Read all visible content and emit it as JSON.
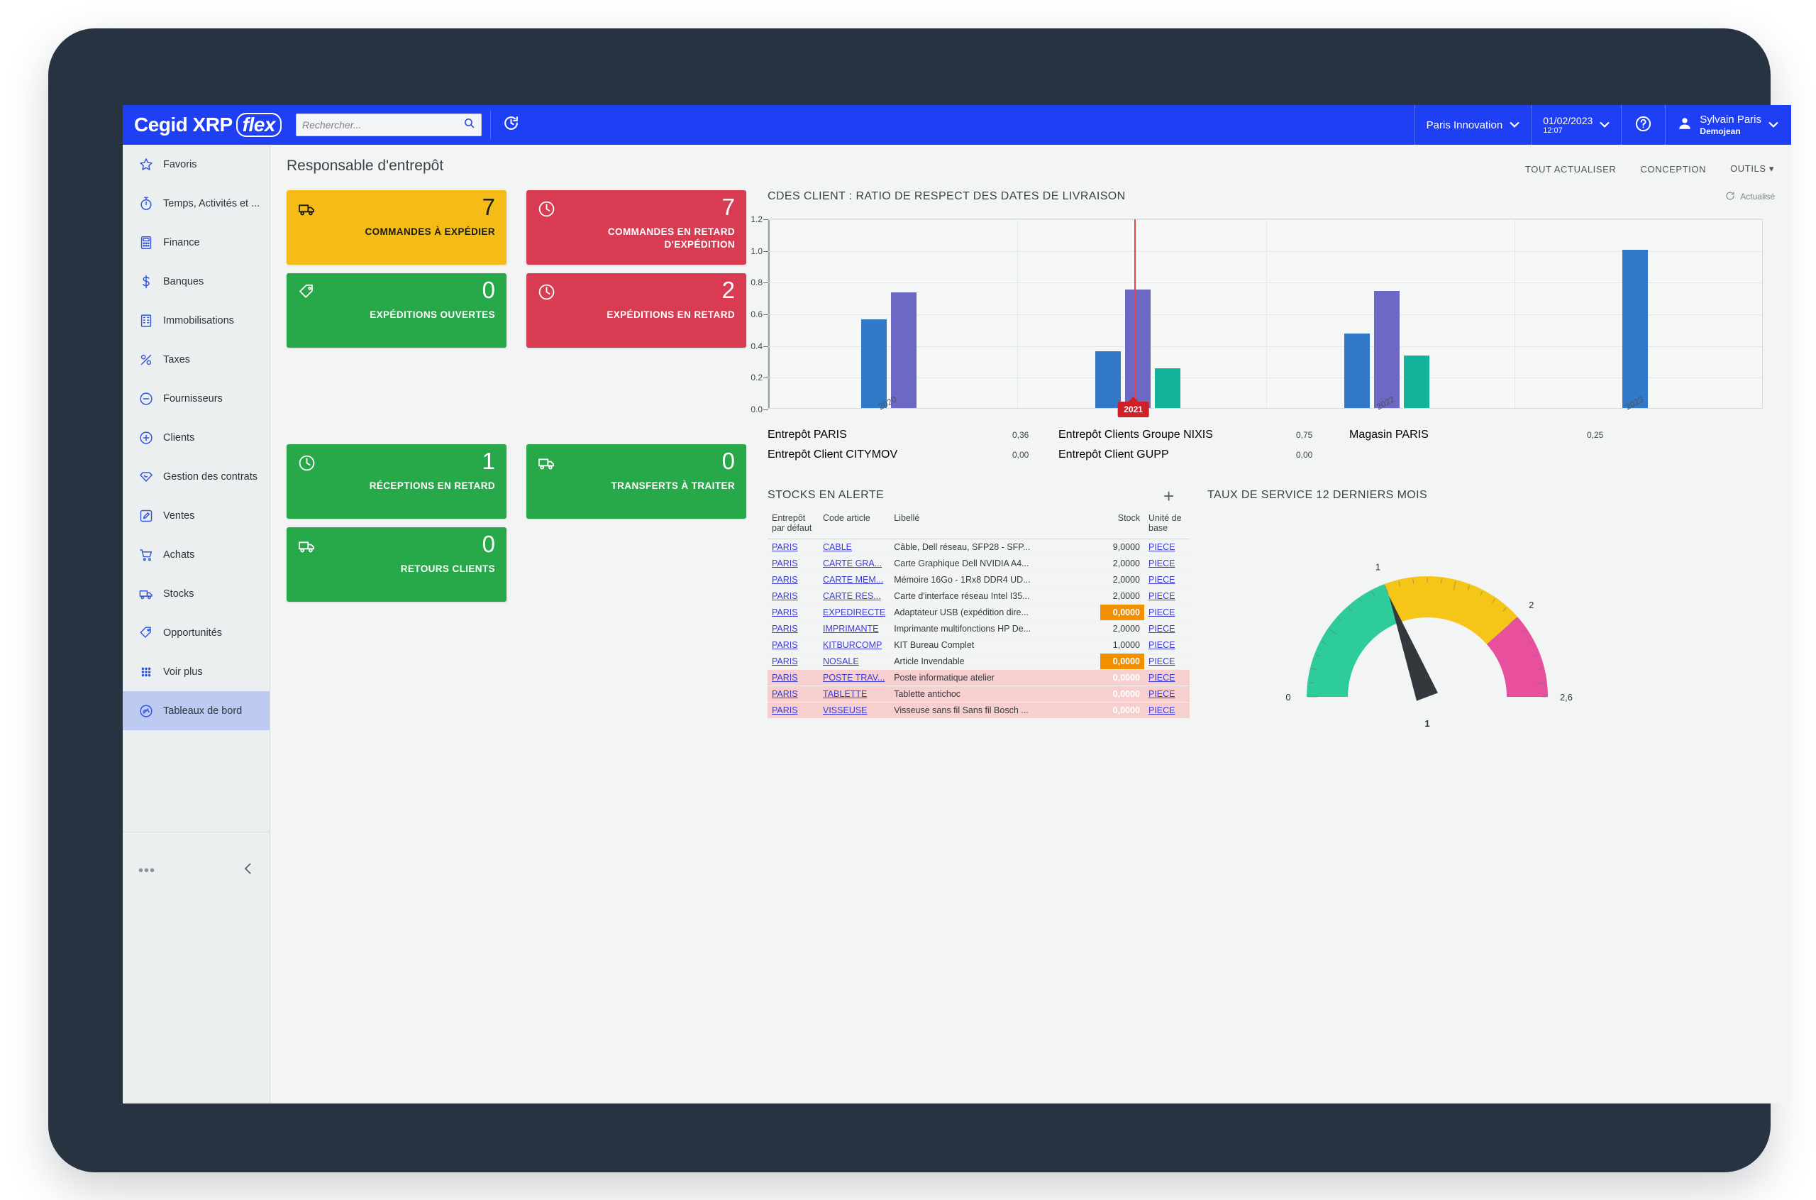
{
  "app": {
    "logo_main": "Cegid XRP",
    "logo_accent": "flex"
  },
  "header": {
    "search_placeholder": "Rechercher...",
    "search_value": "",
    "search_icon": "search-icon",
    "history_icon": "history-refresh-icon",
    "org": "Paris Innovation",
    "date": "01/02/2023",
    "time": "12:07",
    "help_icon": "help-circle-icon",
    "user_icon": "user-avatar-icon",
    "user_name": "Sylvain Paris",
    "user_sub": "Demojean",
    "caret": "⌄"
  },
  "page": {
    "title": "Responsable d'entrepôt",
    "actions": [
      "TOUT ACTUALISER",
      "CONCEPTION",
      "OUTILS ▾"
    ]
  },
  "sidebar": {
    "items": [
      {
        "label": "Favoris",
        "icon": "star-icon",
        "active": false
      },
      {
        "label": "Temps, Activités et ...",
        "icon": "stopwatch-icon",
        "active": false
      },
      {
        "label": "Finance",
        "icon": "calculator-icon",
        "active": false
      },
      {
        "label": "Banques",
        "icon": "dollar-icon",
        "active": false
      },
      {
        "label": "Immobilisations",
        "icon": "building-icon",
        "active": false
      },
      {
        "label": "Taxes",
        "icon": "percent-icon",
        "active": false
      },
      {
        "label": "Fournisseurs",
        "icon": "minus-circle-icon",
        "active": false
      },
      {
        "label": "Clients",
        "icon": "plus-circle-icon",
        "active": false
      },
      {
        "label": "Gestion des contrats",
        "icon": "contract-icon",
        "active": false
      },
      {
        "label": "Ventes",
        "icon": "pencil-square-icon",
        "active": false
      },
      {
        "label": "Achats",
        "icon": "cart-icon",
        "active": false
      },
      {
        "label": "Stocks",
        "icon": "truck-icon",
        "active": false
      },
      {
        "label": "Opportunités",
        "icon": "tag-icon",
        "active": false
      },
      {
        "label": "Voir plus",
        "icon": "grid-dots-icon",
        "active": false
      },
      {
        "label": "Tableaux de bord",
        "icon": "gauge-icon",
        "active": true
      }
    ],
    "more_icon": "ellipsis-icon",
    "collapse_icon": "chevron-left-icon"
  },
  "tiles": [
    {
      "value": "7",
      "label": "COMMANDES À EXPÉDIER",
      "color": "amber",
      "icon": "truck-icon"
    },
    {
      "value": "7",
      "label": "COMMANDES EN RETARD D'EXPÉDITION",
      "color": "red",
      "icon": "clock-icon"
    },
    {
      "value": "0",
      "label": "EXPÉDITIONS OUVERTES",
      "color": "green",
      "icon": "tag-icon"
    },
    {
      "value": "2",
      "label": "EXPÉDITIONS EN RETARD",
      "color": "red",
      "icon": "clock-icon"
    },
    {
      "value": "1",
      "label": "RÉCEPTIONS EN RETARD",
      "color": "green",
      "icon": "clock-icon"
    },
    {
      "value": "0",
      "label": "TRANSFERTS À TRAITER",
      "color": "green",
      "icon": "truck-icon"
    },
    {
      "value": "0",
      "label": "RETOURS CLIENTS",
      "color": "green",
      "icon": "truck-icon"
    }
  ],
  "chart_panel": {
    "refresh_label": "Actualisé",
    "refresh_icon": "refresh-icon"
  },
  "stocks": {
    "title": "STOCKS EN ALERTE",
    "add_label": "+",
    "columns": [
      "Entrepôt par défaut",
      "Code article",
      "Libellé",
      "Stock",
      "Unité de base"
    ],
    "rows": [
      {
        "entrepot": "PARIS",
        "code": "CABLE",
        "libelle": "Câble, Dell réseau, SFP28 - SFP...",
        "stock": "9,0000",
        "unite": "PIECE",
        "alert": false,
        "danger": false
      },
      {
        "entrepot": "PARIS",
        "code": "CARTE GRA...",
        "libelle": "Carte Graphique Dell NVIDIA A4...",
        "stock": "2,0000",
        "unite": "PIECE",
        "alert": false,
        "danger": false
      },
      {
        "entrepot": "PARIS",
        "code": "CARTE MEM...",
        "libelle": "Mémoire 16Go - 1Rx8 DDR4 UD...",
        "stock": "2,0000",
        "unite": "PIECE",
        "alert": false,
        "danger": false
      },
      {
        "entrepot": "PARIS",
        "code": "CARTE RES...",
        "libelle": "Carte d'interface réseau Intel I35...",
        "stock": "2,0000",
        "unite": "PIECE",
        "alert": false,
        "danger": false
      },
      {
        "entrepot": "PARIS",
        "code": "EXPEDIRECTE",
        "libelle": "Adaptateur USB (expédition dire...",
        "stock": "0,0000",
        "unite": "PIECE",
        "alert": true,
        "danger": false
      },
      {
        "entrepot": "PARIS",
        "code": "IMPRIMANTE",
        "libelle": "Imprimante multifonctions HP De...",
        "stock": "2,0000",
        "unite": "PIECE",
        "alert": false,
        "danger": false
      },
      {
        "entrepot": "PARIS",
        "code": "KITBURCOMP",
        "libelle": "KIT Bureau Complet",
        "stock": "1,0000",
        "unite": "PIECE",
        "alert": false,
        "danger": false
      },
      {
        "entrepot": "PARIS",
        "code": "NOSALE",
        "libelle": "Article Invendable",
        "stock": "0,0000",
        "unite": "PIECE",
        "alert": true,
        "danger": false
      },
      {
        "entrepot": "PARIS",
        "code": "POSTE TRAV...",
        "libelle": "Poste informatique atelier",
        "stock": "0,0000",
        "unite": "PIECE",
        "alert": true,
        "danger": true
      },
      {
        "entrepot": "PARIS",
        "code": "TABLETTE",
        "libelle": "Tablette antichoc",
        "stock": "0,0000",
        "unite": "PIECE",
        "alert": true,
        "danger": true
      },
      {
        "entrepot": "PARIS",
        "code": "VISSEUSE",
        "libelle": "Visseuse sans fil Sans fil Bosch ...",
        "stock": "0,0000",
        "unite": "PIECE",
        "alert": true,
        "danger": true
      }
    ]
  },
  "chart_data": [
    {
      "type": "bar",
      "title": "CDES CLIENT : RATIO DE RESPECT DES DATES DE LIVRAISON",
      "xlabel": "",
      "ylabel": "",
      "ylim": [
        0.0,
        1.2
      ],
      "yticks": [
        "0.0",
        "0.2",
        "0.4",
        "0.6",
        "0.8",
        "1.0",
        "1.2"
      ],
      "categories": [
        "2020",
        "2021",
        "2022",
        "2023"
      ],
      "highlighted_category": "2021",
      "grid": true,
      "legend_position": "bottom",
      "series": [
        {
          "name": "Entrepôt PARIS",
          "color": "#3278c8",
          "legend_value": "0,36",
          "values": [
            0.56,
            0.36,
            0.47,
            1.0
          ]
        },
        {
          "name": "Entrepôt Clients Groupe NIXIS",
          "color": "#6d68c4",
          "legend_value": "0,75",
          "values": [
            0.73,
            0.75,
            0.74,
            null
          ]
        },
        {
          "name": "Magasin PARIS",
          "color": "#13b39b",
          "legend_value": "0,25",
          "values": [
            null,
            0.25,
            0.33,
            null
          ]
        },
        {
          "name": "Entrepôt Client CITYMOV",
          "color": "#f5c37a",
          "legend_value": "0,00",
          "values": [
            null,
            null,
            null,
            null
          ]
        },
        {
          "name": "Entrepôt Client GUPP",
          "color": "#e5197f",
          "legend_value": "0,00",
          "values": [
            null,
            null,
            null,
            null
          ]
        }
      ]
    },
    {
      "type": "gauge",
      "title": "TAUX DE SERVICE 12 DERNIERS MOIS",
      "value": 1,
      "value_label": "1",
      "min": 0,
      "max": 2.6,
      "min_label": "0",
      "max_label": "2,6",
      "tick_labels": [
        "0",
        "1",
        "2",
        "2,6"
      ],
      "bands": [
        {
          "from": 0,
          "to": 1,
          "color": "#2ecc9b"
        },
        {
          "from": 1,
          "to": 2,
          "color": "#f5c518"
        },
        {
          "from": 2,
          "to": 2.6,
          "color": "#e84f9c"
        }
      ]
    }
  ]
}
